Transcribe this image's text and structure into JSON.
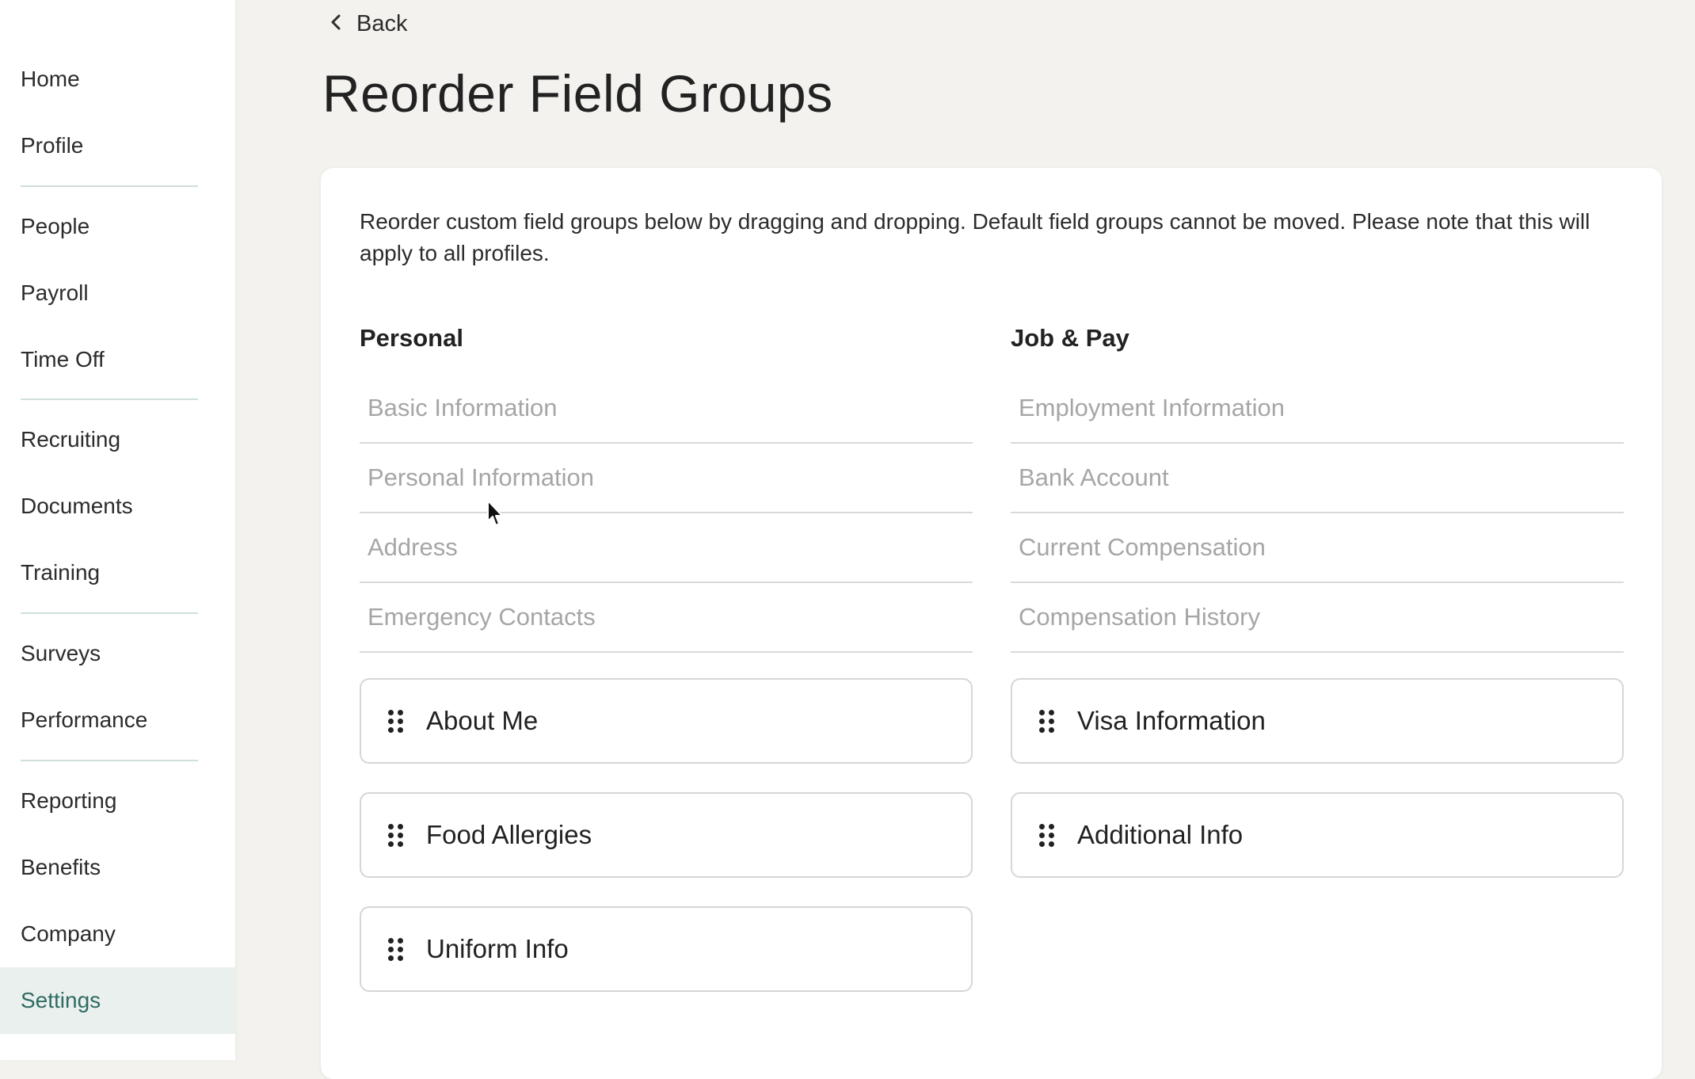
{
  "sidebar": {
    "items": [
      {
        "label": "Home"
      },
      {
        "label": "Profile"
      },
      {
        "label": "People"
      },
      {
        "label": "Payroll"
      },
      {
        "label": "Time Off"
      },
      {
        "label": "Recruiting"
      },
      {
        "label": "Documents"
      },
      {
        "label": "Training"
      },
      {
        "label": "Surveys"
      },
      {
        "label": "Performance"
      },
      {
        "label": "Reporting"
      },
      {
        "label": "Benefits"
      },
      {
        "label": "Company"
      },
      {
        "label": "Settings",
        "active": true
      }
    ]
  },
  "header": {
    "back_label": "Back",
    "back_icon": "chevron-left-icon",
    "title": "Reorder Field Groups"
  },
  "card": {
    "description": "Reorder custom field groups below by dragging and dropping. Default field groups cannot be moved. Please note that this will apply to all profiles."
  },
  "personal": {
    "title": "Personal",
    "default_groups": [
      "Basic Information",
      "Personal Information",
      "Address",
      "Emergency Contacts"
    ],
    "custom_groups": [
      "About Me",
      "Food Allergies",
      "Uniform Info"
    ]
  },
  "job_pay": {
    "title": "Job & Pay",
    "default_groups": [
      "Employment Information",
      "Bank Account",
      "Current Compensation",
      "Compensation History"
    ],
    "custom_groups": [
      "Visa Information",
      "Additional Info"
    ]
  },
  "colors": {
    "active_nav_bg": "#eaf0ee",
    "active_nav_text": "#2f6b64",
    "divider": "#cfe0dd",
    "muted_text": "#a6a6a6"
  }
}
